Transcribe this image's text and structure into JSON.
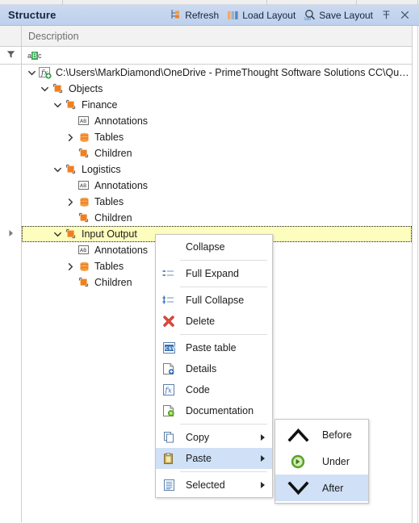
{
  "window": {
    "title": "Structure"
  },
  "toolbar": {
    "buttons": [
      {
        "label": "Refresh",
        "icon": "refresh-tree-icon"
      },
      {
        "label": "Load Layout",
        "icon": "load-layout-icon"
      },
      {
        "label": "Save Layout",
        "icon": "save-layout-icon"
      }
    ],
    "pin_label": "",
    "close_label": ""
  },
  "grid": {
    "column_header": "Description",
    "filter_placeholder": "",
    "filter_abc": {
      "a": "a",
      "b": "B",
      "c": "c"
    }
  },
  "tree": {
    "rows": [
      {
        "label": "C:\\Users\\MarkDiamond\\OneDrive - PrimeThought Software Solutions CC\\QubeXL\\CTS.Qub…",
        "depth": 0,
        "icon": "formula-add-icon",
        "expander": "expanded",
        "selected": false
      },
      {
        "label": "Objects",
        "depth": 1,
        "icon": "object-folder-icon",
        "expander": "expanded",
        "selected": false
      },
      {
        "label": "Finance",
        "depth": 2,
        "icon": "object-folder-icon",
        "expander": "expanded",
        "selected": false
      },
      {
        "label": "Annotations",
        "depth": 3,
        "icon": "annotation-ab-icon",
        "expander": "none",
        "selected": false
      },
      {
        "label": "Tables",
        "depth": 3,
        "icon": "database-table-icon",
        "expander": "collapsed",
        "selected": false
      },
      {
        "label": "Children",
        "depth": 3,
        "icon": "object-folder-icon",
        "expander": "none",
        "selected": false
      },
      {
        "label": "Logistics",
        "depth": 2,
        "icon": "object-folder-icon",
        "expander": "expanded",
        "selected": false
      },
      {
        "label": "Annotations",
        "depth": 3,
        "icon": "annotation-ab-icon",
        "expander": "none",
        "selected": false
      },
      {
        "label": "Tables",
        "depth": 3,
        "icon": "database-table-icon",
        "expander": "collapsed",
        "selected": false
      },
      {
        "label": "Children",
        "depth": 3,
        "icon": "object-folder-icon",
        "expander": "none",
        "selected": false
      },
      {
        "label": "Input Output",
        "depth": 2,
        "icon": "object-folder-icon",
        "expander": "expanded",
        "selected": true
      },
      {
        "label": "Annotations",
        "depth": 3,
        "icon": "annotation-ab-icon",
        "expander": "none",
        "selected": false
      },
      {
        "label": "Tables",
        "depth": 3,
        "icon": "database-table-icon",
        "expander": "collapsed",
        "selected": false
      },
      {
        "label": "Children",
        "depth": 3,
        "icon": "object-folder-icon",
        "expander": "none",
        "selected": false
      }
    ]
  },
  "context_menu": {
    "items": [
      {
        "label": "Collapse",
        "icon": "none",
        "submenu": false,
        "highlighted": false,
        "separator_after": true
      },
      {
        "label": "Full Expand",
        "icon": "full-expand-icon",
        "submenu": false,
        "highlighted": false,
        "separator_after": true
      },
      {
        "label": "Full Collapse",
        "icon": "full-collapse-icon",
        "submenu": false,
        "highlighted": false,
        "separator_after": false
      },
      {
        "label": "Delete",
        "icon": "delete-x-icon",
        "submenu": false,
        "highlighted": false,
        "separator_after": true
      },
      {
        "label": "Paste table",
        "icon": "csv-icon",
        "submenu": false,
        "highlighted": false,
        "separator_after": false
      },
      {
        "label": "Details",
        "icon": "details-icon",
        "submenu": false,
        "highlighted": false,
        "separator_after": false
      },
      {
        "label": "Code",
        "icon": "code-fx-icon",
        "submenu": false,
        "highlighted": false,
        "separator_after": false
      },
      {
        "label": "Documentation",
        "icon": "documentation-icon",
        "submenu": false,
        "highlighted": false,
        "separator_after": true
      },
      {
        "label": "Copy",
        "icon": "copy-icon",
        "submenu": true,
        "highlighted": false,
        "separator_after": false
      },
      {
        "label": "Paste",
        "icon": "paste-icon",
        "submenu": true,
        "highlighted": true,
        "separator_after": true
      },
      {
        "label": "Selected",
        "icon": "selected-list-icon",
        "submenu": true,
        "highlighted": false,
        "separator_after": false
      }
    ],
    "submenu": {
      "items": [
        {
          "label": "Before",
          "icon": "chevron-up-icon",
          "highlighted": false
        },
        {
          "label": "Under",
          "icon": "under-arrow-icon",
          "highlighted": false
        },
        {
          "label": "After",
          "icon": "chevron-down-icon",
          "highlighted": true
        }
      ]
    }
  },
  "colors": {
    "title_bar": "#c3d4ef",
    "selection_yellow": "#fdfdbd",
    "menu_highlight": "#cfe0f7",
    "accent_orange": "#ef8022",
    "accent_green": "#3aa655",
    "accent_blue": "#2f6fb5"
  }
}
